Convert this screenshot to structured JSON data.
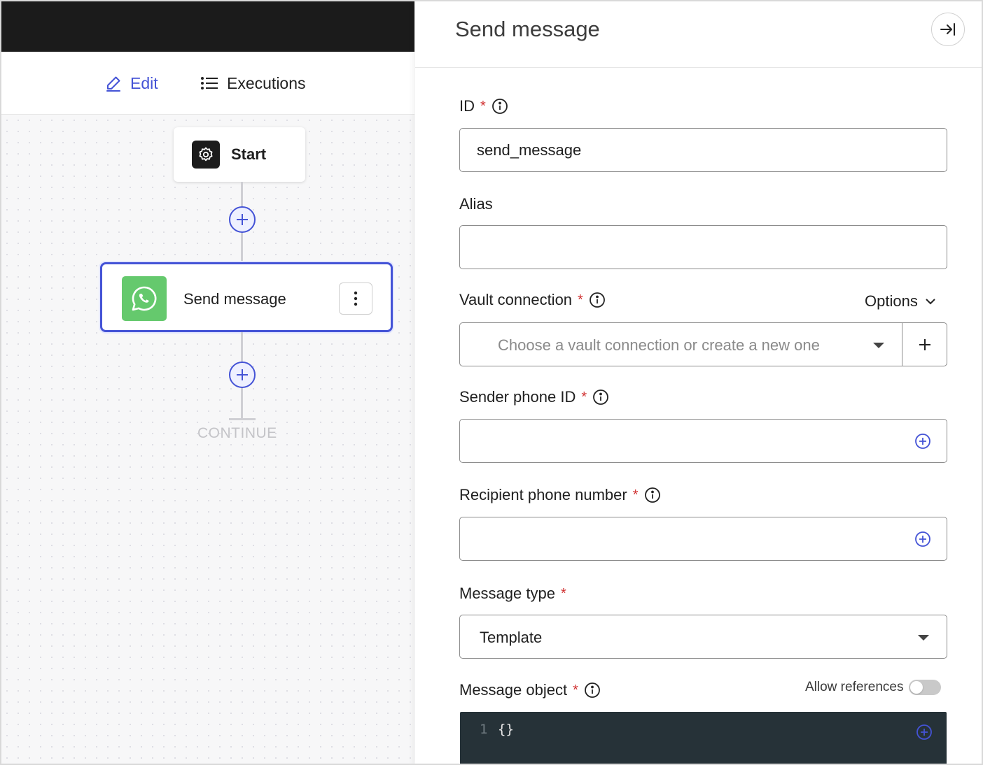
{
  "tabs": {
    "edit_label": "Edit",
    "executions_label": "Executions"
  },
  "canvas": {
    "start_label": "Start",
    "send_node_label": "Send message",
    "continue_label": "CONTINUE"
  },
  "panel": {
    "title": "Send message",
    "fields": {
      "id": {
        "label": "ID",
        "value": "send_message"
      },
      "alias": {
        "label": "Alias",
        "value": ""
      },
      "vault": {
        "label": "Vault connection",
        "options_label": "Options",
        "placeholder": "Choose a vault connection or create a new one",
        "add_symbol": "+"
      },
      "sender_phone": {
        "label": "Sender phone ID",
        "value": ""
      },
      "recipient_phone": {
        "label": "Recipient phone number",
        "value": ""
      },
      "message_type": {
        "label": "Message type",
        "value": "Template"
      },
      "message_object": {
        "label": "Message object",
        "allow_references_label": "Allow references",
        "allow_references_on": false,
        "line_number": "1",
        "code": "{}"
      }
    },
    "required_marker": "*"
  },
  "colors": {
    "accent": "#4453d6",
    "topbar": "#1b1b1b",
    "whatsapp": "#65c96d",
    "required": "#d03030",
    "code_bg": "#263238"
  }
}
